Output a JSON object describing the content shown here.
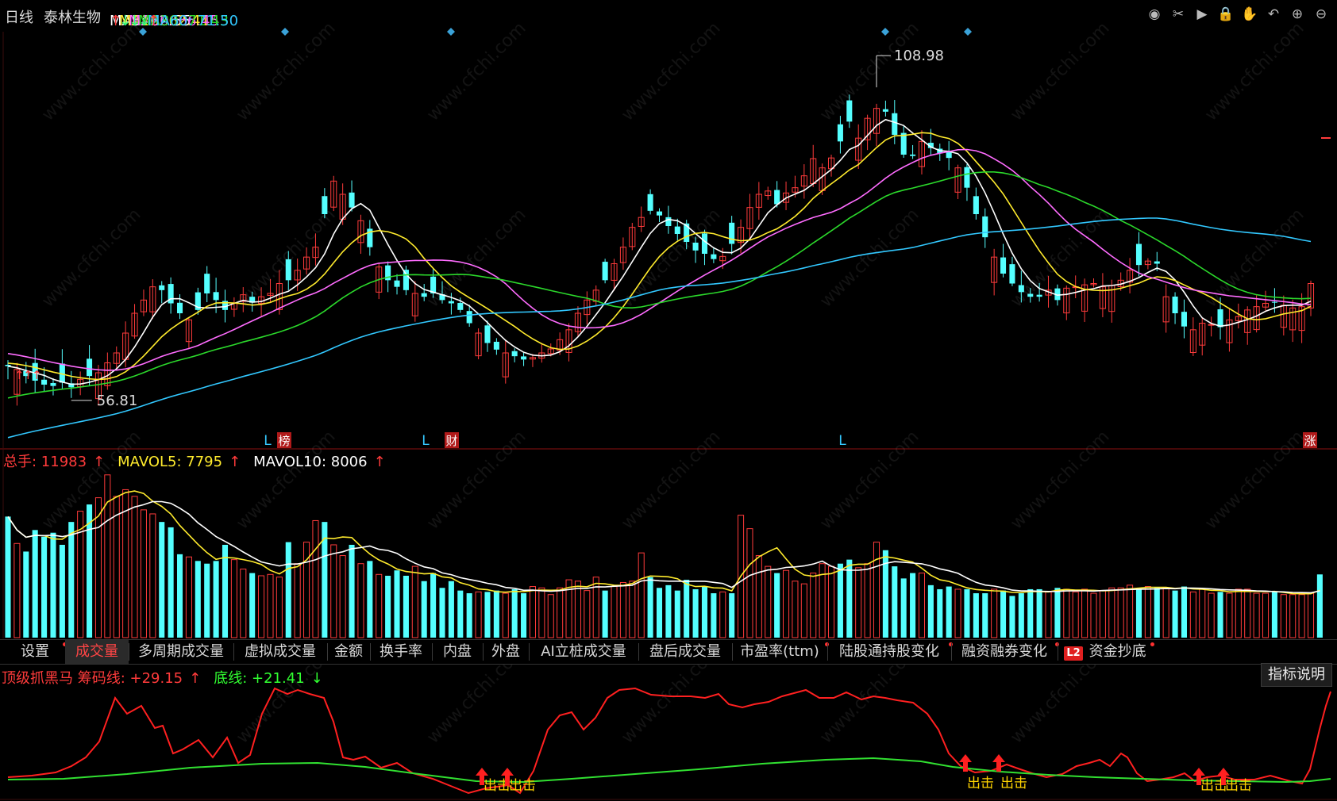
{
  "header": {
    "period": "日线",
    "stock_name": "泰林生物",
    "ma": [
      {
        "label": "MA5:",
        "value": "62.55",
        "arrow": "↑",
        "color": "#ffffff",
        "arrow_color": "#ff3b3b"
      },
      {
        "label": "MA10:",
        "value": "62.41",
        "arrow": "↓",
        "color": "#ffeb2d",
        "arrow_color": "#31ff7d"
      },
      {
        "label": "MA20:",
        "value": "66.45",
        "arrow": "↓",
        "color": "#ff6cff",
        "arrow_color": "#31ff7d"
      },
      {
        "label": "MA30:",
        "value": "71.43",
        "arrow": "↓",
        "color": "#2bd82b",
        "arrow_color": "#31ff7d"
      },
      {
        "label": "MA60:",
        "value": "71.50",
        "arrow": "↑",
        "color": "#32c8ff",
        "arrow_color": "#ff3b3b"
      }
    ]
  },
  "toolbar": [
    {
      "name": "eye-icon",
      "glyph": "◉"
    },
    {
      "name": "scissors-icon",
      "glyph": "✂"
    },
    {
      "name": "play-icon",
      "glyph": "▶"
    },
    {
      "name": "lock-icon",
      "glyph": "🔒"
    },
    {
      "name": "hand-icon",
      "glyph": "✋"
    },
    {
      "name": "undo-icon",
      "glyph": "↶"
    },
    {
      "name": "zoom-in-icon",
      "glyph": "⊕"
    },
    {
      "name": "zoom-out-icon",
      "glyph": "⊖"
    }
  ],
  "annotations": {
    "high_label": "108.98",
    "low_label": "56.81",
    "markers": [
      {
        "text": "L",
        "kind": "L"
      },
      {
        "text": "榜",
        "kind": "box"
      },
      {
        "text": "L",
        "kind": "L"
      },
      {
        "text": "财",
        "kind": "box"
      },
      {
        "text": "L",
        "kind": "L"
      },
      {
        "text": "涨",
        "kind": "box"
      }
    ]
  },
  "volume_header": [
    {
      "label": "总手:",
      "value": "11983",
      "arrow": "↑",
      "color": "#ff3b3b"
    },
    {
      "label": "MAVOL5:",
      "value": "7795",
      "arrow": "↑",
      "color": "#ffeb2d"
    },
    {
      "label": "MAVOL10:",
      "value": "8006",
      "arrow": "↑",
      "color": "#ffffff"
    }
  ],
  "tabs": [
    {
      "label": "设置",
      "active": false,
      "dot": true
    },
    {
      "label": "成交量",
      "active": true,
      "dot": false
    },
    {
      "label": "多周期成交量",
      "active": false,
      "dot": false
    },
    {
      "label": "虚拟成交量",
      "active": false,
      "dot": false
    },
    {
      "label": "金额",
      "active": false,
      "dot": false
    },
    {
      "label": "换手率",
      "active": false,
      "dot": false
    },
    {
      "label": "内盘",
      "active": false,
      "dot": false
    },
    {
      "label": "外盘",
      "active": false,
      "dot": false
    },
    {
      "label": "AI立桩成交量",
      "active": false,
      "dot": false
    },
    {
      "label": "盘后成交量",
      "active": false,
      "dot": false
    },
    {
      "label": "市盈率(ttm)",
      "active": false,
      "dot": true
    },
    {
      "label": "陆股通持股变化",
      "active": false,
      "dot": true
    },
    {
      "label": "融资融券变化",
      "active": false,
      "dot": true
    },
    {
      "label": "资金抄底",
      "active": false,
      "dot": true,
      "badge": "L2"
    }
  ],
  "indicator_header": [
    {
      "label": "顶级抓黑马 筹码线:",
      "value": "+29.15",
      "arrow": "↑",
      "color": "#ff3b3b"
    },
    {
      "label": "底线:",
      "value": "+21.41",
      "arrow": "↓",
      "color": "#31ff31"
    }
  ],
  "indicator_button": "指标说明",
  "signal_label": "出击",
  "watermark": "www.cfchi.com",
  "colors": {
    "up": "#ff3b3b",
    "down": "#54ffff",
    "ma5": "#ffffff",
    "ma10": "#ffeb2d",
    "ma20": "#ff6cff",
    "ma30": "#2bd82b",
    "ma60": "#32c8ff"
  },
  "chart_data": {
    "type": "candlestick",
    "price_range": [
      52,
      112
    ],
    "high_value": 108.98,
    "low_value": 56.81,
    "close": [
      62.0,
      61.5,
      60.5,
      59.8,
      59.2,
      59.0,
      59.5,
      58.8,
      60.0,
      60.5,
      61.0,
      62.5,
      64.0,
      67.0,
      70.0,
      72.0,
      74.0,
      73.5,
      71.5,
      70.0,
      69.0,
      70.5,
      73.0,
      72.0,
      70.5,
      71.5,
      72.8,
      71.6,
      72.5,
      73.0,
      74.5,
      75.0,
      76.5,
      78.5,
      80.0,
      85.0,
      90.0,
      88.0,
      86.0,
      84.0,
      80.0,
      77.0,
      75.0,
      74.0,
      73.5,
      73.0,
      72.5,
      73.0,
      72.0,
      71.5,
      70.5,
      68.5,
      67.0,
      65.5,
      64.5,
      64.0,
      63.5,
      63.0,
      63.3,
      64.0,
      64.6,
      66.0,
      67.5,
      70.0,
      72.0,
      73.5,
      75.0,
      77.5,
      80.0,
      83.0,
      84.5,
      85.5,
      84.8,
      83.2,
      82.0,
      80.8,
      79.5,
      79.0,
      78.2,
      78.6,
      80.5,
      83.0,
      86.0,
      88.0,
      88.5,
      86.5,
      88.2,
      89.0,
      90.8,
      93.4,
      92.0,
      93.5,
      96.0,
      99.0,
      96.5,
      99.5,
      101.0,
      100.5,
      97.0,
      94.0,
      93.8,
      96.0,
      95.0,
      94.2,
      93.5,
      92.0,
      89.0,
      85.0,
      81.5,
      78.5,
      76.0,
      74.5,
      73.2,
      72.5,
      72.5,
      73.5,
      72.0,
      73.8,
      74.0,
      74.3,
      74.5,
      74.0,
      74.2,
      75.0,
      76.5,
      77.3,
      77.9,
      77.5,
      72.5,
      70.0,
      68.0,
      67.5,
      68.5,
      68.3,
      67.9,
      69.0,
      69.5,
      70.5,
      71.0,
      71.5,
      71.6,
      71.2,
      70.8,
      71.0,
      74.5
    ],
    "volume": [
      9000,
      7000,
      6400,
      8000,
      7500,
      7800,
      6900,
      8600,
      9400,
      9900,
      10400,
      12100,
      10500,
      11000,
      10500,
      9500,
      9200,
      8600,
      8200,
      6200,
      6000,
      5700,
      5500,
      5700,
      6900,
      5800,
      5100,
      4800,
      4600,
      4700,
      4500,
      7100,
      5500,
      7100,
      8700,
      8600,
      6900,
      6100,
      6900,
      5500,
      5700,
      4700,
      4600,
      5000,
      4600,
      5300,
      4200,
      4800,
      3700,
      4200,
      3500,
      3300,
      3400,
      3400,
      3500,
      3300,
      3600,
      3300,
      3800,
      3700,
      3200,
      3700,
      4300,
      4200,
      3500,
      4500,
      3500,
      3800,
      4100,
      4200,
      6300,
      4500,
      3700,
      3900,
      3500,
      4300,
      3600,
      3800,
      3300,
      3400,
      3300,
      9100,
      8100,
      6100,
      5300,
      4800,
      5000,
      4200,
      4000,
      4800,
      5500,
      5300,
      5500,
      5800,
      5200,
      5500,
      7100,
      6500,
      5300,
      4400,
      4800,
      4800,
      3900,
      3600,
      3800,
      3600,
      3600,
      3300,
      3300,
      3600,
      3500,
      3100,
      3300,
      3600,
      3600,
      3400,
      3700,
      3600,
      3400,
      3600,
      3300,
      3500,
      3700,
      3700,
      3900,
      3600,
      3800,
      3700,
      3700,
      3500,
      3800,
      3400,
      3600,
      3300,
      3400,
      3300,
      3600,
      3600,
      3300,
      3300,
      3400,
      3200,
      3200,
      3200,
      3300,
      4700
    ],
    "mavol5_last": 7795,
    "mavol10_last": 8006,
    "chip_line_last": 29.15,
    "base_line_last": 21.41
  }
}
